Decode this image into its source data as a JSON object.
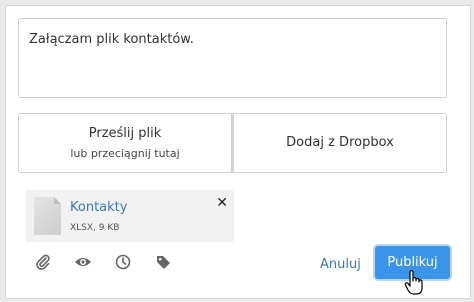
{
  "composer": {
    "message_text": "Załączam plik kontaktów."
  },
  "upload": {
    "send_file_label": "Prześlij plik",
    "send_file_sub": "lub przeciągnij tutaj",
    "dropbox_label": "Dodaj z Dropbox"
  },
  "attachment": {
    "name": "Kontakty",
    "meta": "XLSX, 9 KB",
    "remove_glyph": "✕"
  },
  "toolbar": {
    "icons": [
      "paperclip-icon",
      "eye-icon",
      "clock-icon",
      "tag-icon"
    ],
    "cancel_label": "Anuluj",
    "publish_label": "Publikuj"
  },
  "colors": {
    "accent": "#3a95ea",
    "link": "#3a78b8",
    "icon": "#666666"
  }
}
